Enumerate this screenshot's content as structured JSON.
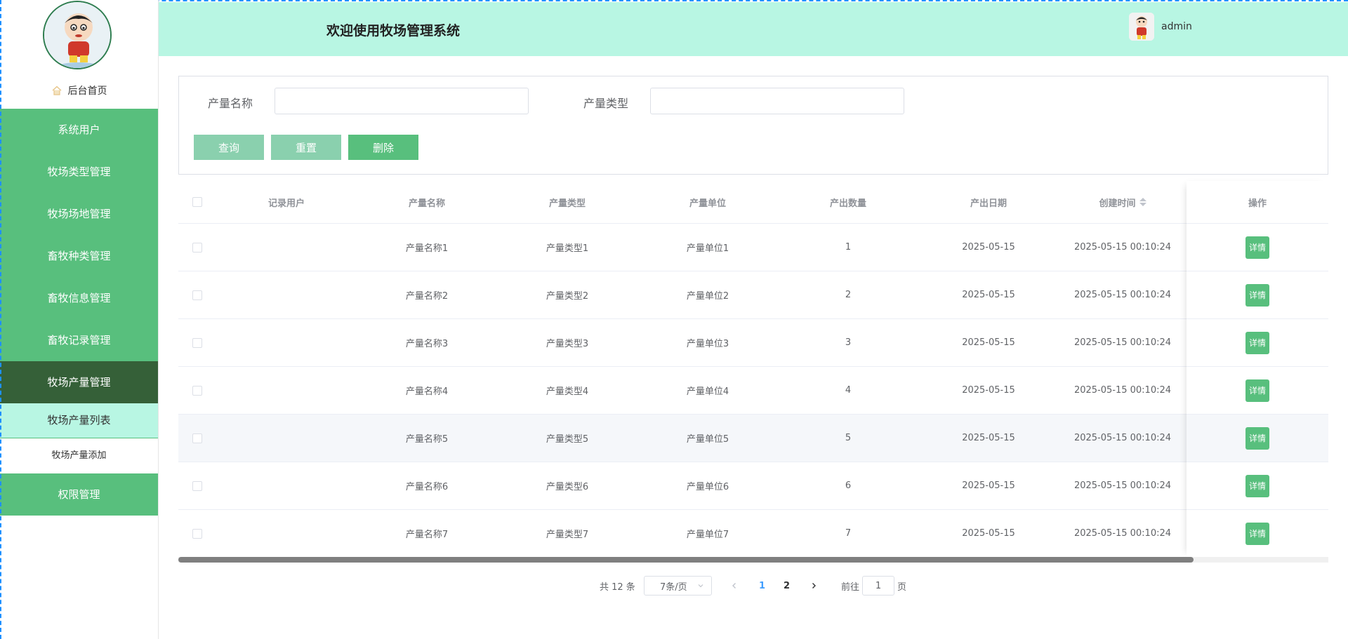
{
  "app": {
    "title": "欢迎使用牧场管理系统",
    "username": "admin"
  },
  "sidebar": {
    "home_label": "后台首页",
    "menu": [
      {
        "label": "系统用户"
      },
      {
        "label": "牧场类型管理"
      },
      {
        "label": "牧场场地管理"
      },
      {
        "label": "畜牧种类管理"
      },
      {
        "label": "畜牧信息管理"
      },
      {
        "label": "畜牧记录管理"
      },
      {
        "label": "牧场产量管理"
      }
    ],
    "submenu": [
      {
        "label": "牧场产量列表"
      },
      {
        "label": "牧场产量添加"
      }
    ],
    "last_menu": {
      "label": "权限管理"
    }
  },
  "search": {
    "name_label": "产量名称",
    "name_value": "",
    "type_label": "产量类型",
    "type_value": "",
    "query_button": "查询",
    "reset_button": "重置",
    "delete_button": "删除"
  },
  "table": {
    "columns": [
      "记录用户",
      "产量名称",
      "产量类型",
      "产量单位",
      "产出数量",
      "产出日期",
      "创建时间",
      "操作"
    ],
    "detail_label": "详情",
    "rows": [
      {
        "user": "",
        "name": "产量名称1",
        "type": "产量类型1",
        "unit": "产量单位1",
        "qty": "1",
        "date": "2025-05-15",
        "created": "2025-05-15 00:10:24"
      },
      {
        "user": "",
        "name": "产量名称2",
        "type": "产量类型2",
        "unit": "产量单位2",
        "qty": "2",
        "date": "2025-05-15",
        "created": "2025-05-15 00:10:24"
      },
      {
        "user": "",
        "name": "产量名称3",
        "type": "产量类型3",
        "unit": "产量单位3",
        "qty": "3",
        "date": "2025-05-15",
        "created": "2025-05-15 00:10:24"
      },
      {
        "user": "",
        "name": "产量名称4",
        "type": "产量类型4",
        "unit": "产量单位4",
        "qty": "4",
        "date": "2025-05-15",
        "created": "2025-05-15 00:10:24"
      },
      {
        "user": "",
        "name": "产量名称5",
        "type": "产量类型5",
        "unit": "产量单位5",
        "qty": "5",
        "date": "2025-05-15",
        "created": "2025-05-15 00:10:24"
      },
      {
        "user": "",
        "name": "产量名称6",
        "type": "产量类型6",
        "unit": "产量单位6",
        "qty": "6",
        "date": "2025-05-15",
        "created": "2025-05-15 00:10:24"
      },
      {
        "user": "",
        "name": "产量名称7",
        "type": "产量类型7",
        "unit": "产量单位7",
        "qty": "7",
        "date": "2025-05-15",
        "created": "2025-05-15 00:10:24"
      }
    ]
  },
  "pagination": {
    "total": "共 12 条",
    "page_size": "7条/页",
    "pages": [
      "1",
      "2"
    ],
    "current": "1",
    "goto_prefix": "前往",
    "goto_value": "1",
    "goto_suffix": "页"
  },
  "colors": {
    "menu_green": "#58bf7d",
    "menu_active": "#356038",
    "header_bg": "#b8f6e3",
    "link_blue": "#409eff"
  }
}
